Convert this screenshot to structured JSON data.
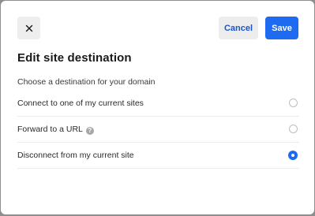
{
  "dialog": {
    "title": "Edit site destination",
    "subtitle": "Choose a destination for your domain",
    "close_icon": "close-icon",
    "cancel_label": "Cancel",
    "save_label": "Save",
    "options": [
      {
        "label": "Connect to one of my current sites",
        "selected": false
      },
      {
        "label": "Forward to a URL",
        "selected": false,
        "help_icon": "question-icon",
        "help_glyph": "?"
      },
      {
        "label": "Disconnect from my current site",
        "selected": true
      }
    ]
  },
  "colors": {
    "primary": "#1e6bf1",
    "cancel_text": "#1c54c9",
    "button_bg": "#ededee"
  }
}
